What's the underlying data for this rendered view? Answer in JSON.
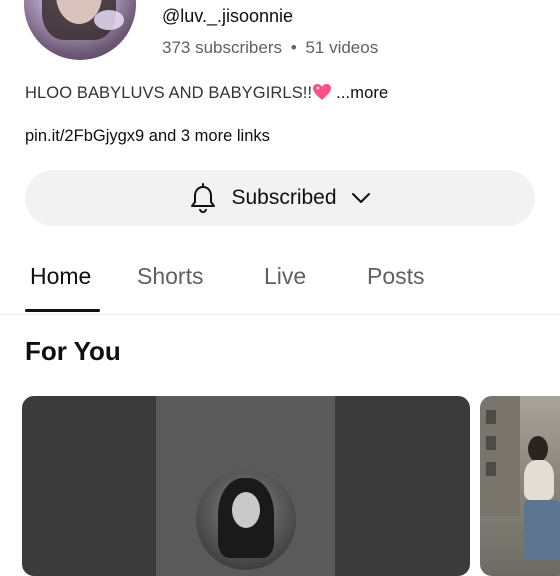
{
  "channel": {
    "handle": "@luv._.jisoonnie",
    "subscribers": "373 subscribers",
    "separator": "•",
    "videos": "51 videos",
    "description": "HLOO BABYLUVS AND BABYGIRLS!!",
    "description_emoji": "sparkling-heart",
    "more_label": "...more",
    "links_text": "pin.it/2FbGjygx9 and 3 more links"
  },
  "subscribe_button": {
    "label": "Subscribed",
    "icon_left": "bell-icon",
    "icon_right": "chevron-down-icon"
  },
  "tabs": [
    {
      "label": "Home",
      "active": true
    },
    {
      "label": "Shorts",
      "active": false
    },
    {
      "label": "Live",
      "active": false
    },
    {
      "label": "Posts",
      "active": false
    }
  ],
  "section": {
    "title": "For You"
  },
  "colors": {
    "text_primary": "#0f0f0f",
    "text_secondary": "#606060",
    "button_bg": "#f2f2f2",
    "heart": "#ff4f8b"
  }
}
